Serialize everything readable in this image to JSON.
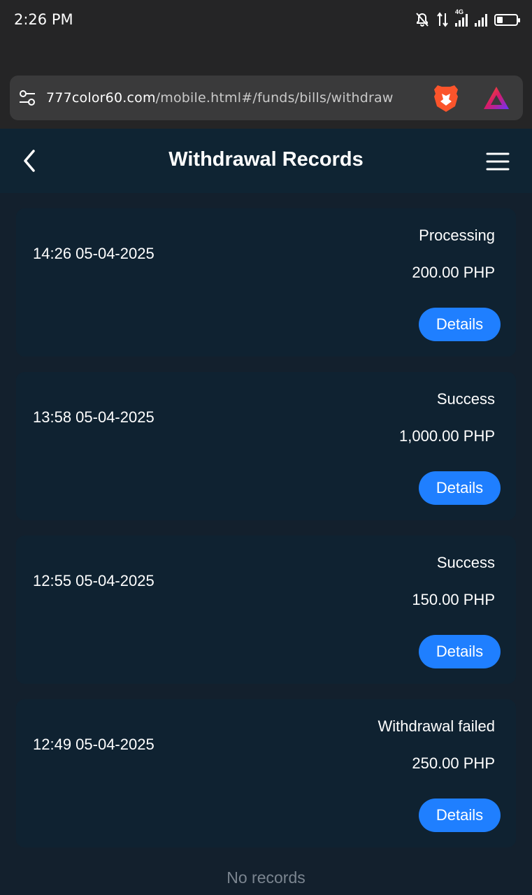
{
  "status_bar": {
    "time": "2:26 PM",
    "network_label": "4G",
    "icons": [
      "mute-notifications-icon",
      "data-transfer-icon",
      "signal-icon",
      "battery-icon"
    ]
  },
  "browser": {
    "url_domain": "777color60.com",
    "url_path": "/mobile.html#/funds/bills/withdraw",
    "icons": [
      "site-settings-icon",
      "brave-shields-icon",
      "brave-rewards-icon"
    ]
  },
  "header": {
    "title": "Withdrawal Records",
    "icons": [
      "back-arrow-icon",
      "hamburger-menu-icon"
    ]
  },
  "records": [
    {
      "datetime": "14:26 05-04-2025",
      "status": "Processing",
      "amount": "200.00 PHP",
      "button": "Details"
    },
    {
      "datetime": "13:58 05-04-2025",
      "status": "Success",
      "amount": "1,000.00 PHP",
      "button": "Details"
    },
    {
      "datetime": "12:55 05-04-2025",
      "status": "Success",
      "amount": "150.00 PHP",
      "button": "Details"
    },
    {
      "datetime": "12:49 05-04-2025",
      "status": "Withdrawal failed",
      "amount": "250.00 PHP",
      "button": "Details"
    }
  ],
  "footer": {
    "no_records": "No records"
  },
  "colors": {
    "page_bg": "#13202d",
    "card_bg": "#0f2231",
    "header_bg": "#0f2433",
    "accent": "#1f7fff",
    "muted_text": "#7b8590"
  }
}
